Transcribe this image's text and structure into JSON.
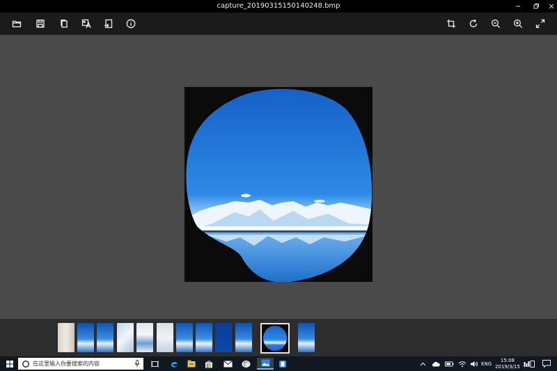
{
  "window": {
    "title": "capture_20190315150140248.bmp"
  },
  "toolbar": {
    "left_icons": [
      "folder-icon",
      "save-icon",
      "copy-icon",
      "text-recognition-icon",
      "export-icon",
      "info-icon"
    ],
    "right_icons": [
      "crop-icon",
      "rotate-icon",
      "zoom-out-icon",
      "zoom-in-icon",
      "fit-screen-icon"
    ]
  },
  "filmstrip": {
    "thumbnail_count": 12,
    "selected_index": 10
  },
  "taskbar": {
    "search_placeholder": "在这里输入你要搜索的内容",
    "language": "ENG",
    "time": "15:08",
    "date": "2019/3/15"
  },
  "colors": {
    "title_bar": "#000000",
    "toolbar": "#1b1b1b",
    "canvas": "#4a4a4a",
    "filmstrip": "#2d2d2d",
    "taskbar": "#101922",
    "sky": "#1e73d2"
  }
}
